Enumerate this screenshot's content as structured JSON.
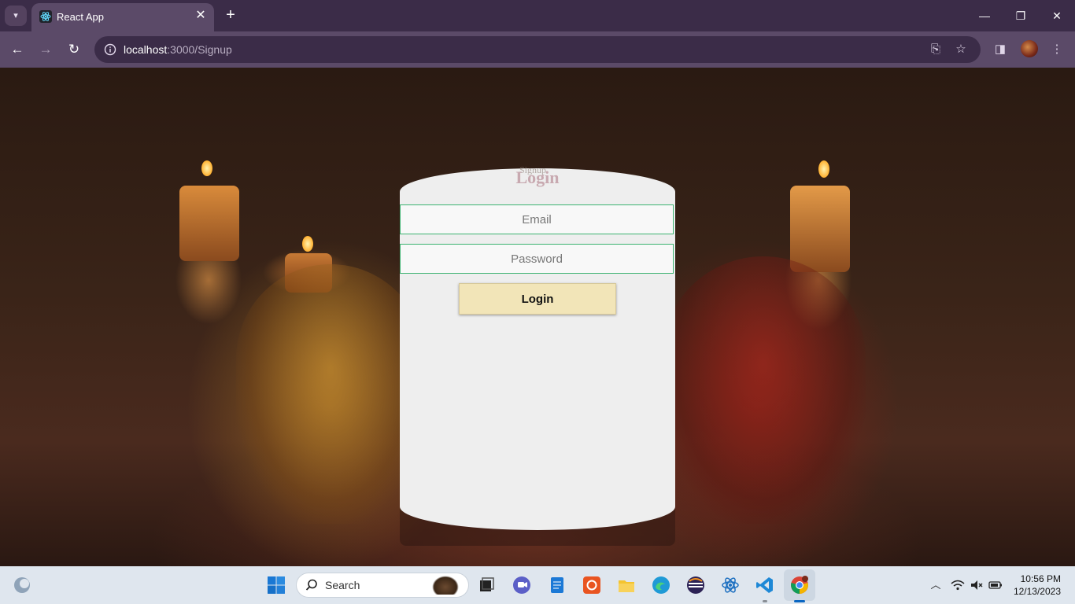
{
  "browser": {
    "tab": {
      "title": "React App"
    },
    "address": {
      "host": "localhost",
      "path": ":3000/Signup"
    }
  },
  "page": {
    "ghost_heading": "Signup",
    "title": "Login",
    "email_placeholder": "Email",
    "password_placeholder": "Password",
    "login_button": "Login"
  },
  "taskbar": {
    "search_label": "Search",
    "clock": {
      "time": "10:56 PM",
      "date": "12/13/2023"
    }
  }
}
